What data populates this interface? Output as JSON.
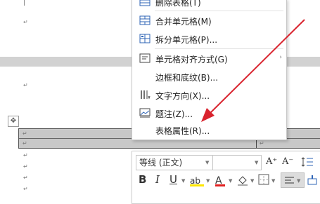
{
  "document": {
    "para_mark": "↵",
    "move_handle_glyph": "✥"
  },
  "context_menu": {
    "items": [
      {
        "label": "删除表格(T)",
        "icon": "delete-table-icon"
      },
      {
        "label": "合并单元格(M)",
        "icon": "merge-cells-icon"
      },
      {
        "label": "拆分单元格(P)...",
        "icon": "split-cells-icon"
      },
      {
        "label": "单元格对齐方式(G)",
        "icon": "cell-alignment-icon",
        "has_submenu": true
      },
      {
        "label": "边框和底纹(B)...",
        "icon": ""
      },
      {
        "label": "文字方向(X)...",
        "icon": "text-direction-icon"
      },
      {
        "label": "题注(Z)...",
        "icon": "caption-icon"
      },
      {
        "label": "表格属性(R)...",
        "icon": ""
      }
    ],
    "submenu_chevron": "›"
  },
  "mini_toolbar": {
    "font_name": "等线 (正文)",
    "font_size": "",
    "increase_font": "A⁺",
    "decrease_font": "A⁻",
    "bold": "B",
    "italic": "I",
    "underline": "U",
    "highlight": "ab",
    "font_color": "A"
  },
  "colors": {
    "arrow": "#d9232e",
    "highlight_bar": "#ffe600",
    "font_color_bar": "#e02020",
    "band": "#d2d2d2"
  }
}
